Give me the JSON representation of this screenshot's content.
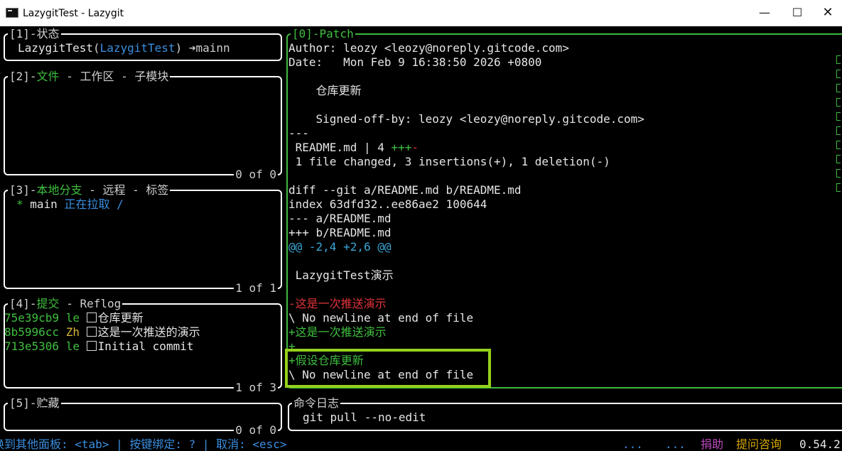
{
  "window": {
    "title": "LazygitTest - Lazygit",
    "minimize_glyph": "—",
    "maximize_glyph": "☐",
    "close_glyph": "✕"
  },
  "status_panel": {
    "title_index": "[1]",
    "title": "状态",
    "repo": "LazygitTest",
    "repo_paren": "LazygitTest",
    "branch": "mainn",
    "arrow": "➜"
  },
  "files_panel": {
    "title_index": "[2]",
    "tab_active": "文件",
    "sep": " - ",
    "tab2": "工作区",
    "tab3": "子模块",
    "footer": "0 of 0"
  },
  "branches_panel": {
    "title_index": "[3]",
    "tab_active": "本地分支",
    "sep": " - ",
    "tab2": "远程",
    "tab3": "标签",
    "items": [
      {
        "marker": "*",
        "name": "main",
        "status": "正在拉取 /"
      }
    ],
    "footer": "1 of 1"
  },
  "commits_panel": {
    "title_index": "[4]",
    "tab_active": "提交",
    "sep": " - ",
    "tab2": "Reflog",
    "items": [
      {
        "hash": "75e39cb9",
        "author": "le",
        "message": "仓库更新"
      },
      {
        "hash": "8b5996cc",
        "author": "Zh",
        "message": "这是一次推送的演示"
      },
      {
        "hash": "713e5306",
        "author": "le",
        "message": "Initial commit"
      }
    ],
    "footer": "1 of 3"
  },
  "stash_panel": {
    "title_index": "[5]",
    "title": "贮藏",
    "footer": "0 of 0"
  },
  "patch_panel": {
    "title": "[0]-Patch",
    "author_line": "Author: leozy <leozy@noreply.gitcode.com>",
    "date_line": "Date:   Mon Feb 9 16:38:50 2026 +0800",
    "subject": "    仓库更新",
    "signoff": "    Signed-off-by: leozy <leozy@noreply.gitcode.com>",
    "sep": "---",
    "stat_file": " README.md | 4 ",
    "stat_plus": "+++",
    "stat_minus": "-",
    "summary": " 1 file changed, 3 insertions(+), 1 deletion(-)",
    "diff_header": "diff --git a/README.md b/README.md",
    "index_line": "index 63dfd32..ee86ae2 100644",
    "minus_file": "--- a/README.md",
    "plus_file": "+++ b/README.md",
    "hunk": "@@ -2,4 +2,6 @@",
    "context1": " LazygitTest演示",
    "removed1": "-这是一次推送演示",
    "no_newline1": "\\ No newline at end of file",
    "added1": "+这是一次推送演示",
    "added2": "+",
    "added3": "+假设仓库更新",
    "no_newline2": "\\ No newline at end of file"
  },
  "command_log": {
    "title": "命令日志",
    "entry": "git pull --no-edit"
  },
  "status_bar": {
    "hint_text": "换到其他面板: <tab> | 按键绑定: ? | 取消: <esc>",
    "dots": "...",
    "donate": "捐助",
    "ask": "提问咨询",
    "version": "0.54.2"
  }
}
